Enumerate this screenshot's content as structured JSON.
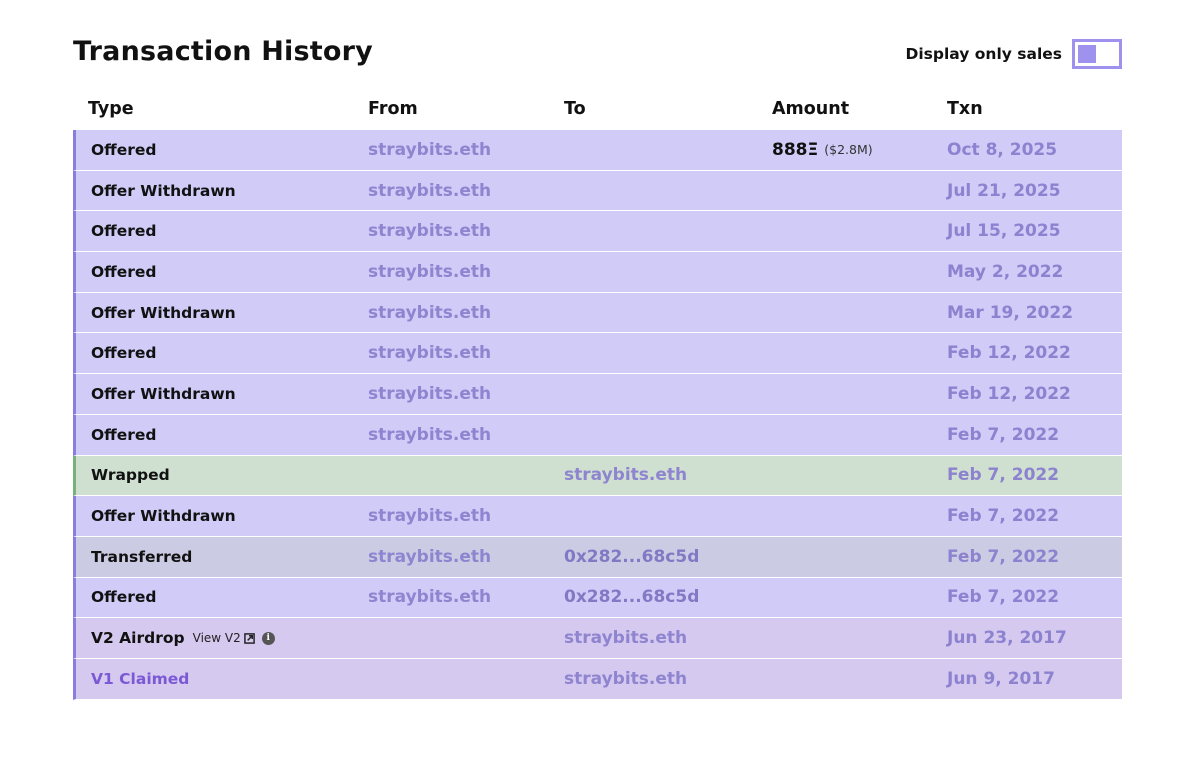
{
  "title": "Transaction History",
  "filter": {
    "label": "Display only sales",
    "accent": "#9e92ee"
  },
  "columns": {
    "type": "Type",
    "from": "From",
    "to": "To",
    "amount": "Amount",
    "txn": "Txn"
  },
  "colors": {
    "offer_bg": "#d1cbf8",
    "wrapped_bg": "#cfe0d0",
    "transferred_bg": "#cbcce4",
    "airdrop_bg": "#d5c9ef",
    "accent_border": "#8a7de0",
    "wrapped_border": "#7ab07c"
  },
  "rows": [
    {
      "type": "Offered",
      "from": "straybits.eth",
      "to": "",
      "amount": "888Ξ",
      "amount_usd": "($2.8M)",
      "date": "Oct 8, 2025",
      "kind": "offer"
    },
    {
      "type": "Offer Withdrawn",
      "from": "straybits.eth",
      "to": "",
      "amount": "",
      "amount_usd": "",
      "date": "Jul 21, 2025",
      "kind": "offer"
    },
    {
      "type": "Offered",
      "from": "straybits.eth",
      "to": "",
      "amount": "",
      "amount_usd": "",
      "date": "Jul 15, 2025",
      "kind": "offer"
    },
    {
      "type": "Offered",
      "from": "straybits.eth",
      "to": "",
      "amount": "",
      "amount_usd": "",
      "date": "May 2, 2022",
      "kind": "offer"
    },
    {
      "type": "Offer Withdrawn",
      "from": "straybits.eth",
      "to": "",
      "amount": "",
      "amount_usd": "",
      "date": "Mar 19, 2022",
      "kind": "offer"
    },
    {
      "type": "Offered",
      "from": "straybits.eth",
      "to": "",
      "amount": "",
      "amount_usd": "",
      "date": "Feb 12, 2022",
      "kind": "offer"
    },
    {
      "type": "Offer Withdrawn",
      "from": "straybits.eth",
      "to": "",
      "amount": "",
      "amount_usd": "",
      "date": "Feb 12, 2022",
      "kind": "offer"
    },
    {
      "type": "Offered",
      "from": "straybits.eth",
      "to": "",
      "amount": "",
      "amount_usd": "",
      "date": "Feb 7, 2022",
      "kind": "offer"
    },
    {
      "type": "Wrapped",
      "from": "",
      "to": "straybits.eth",
      "amount": "",
      "amount_usd": "",
      "date": "Feb 7, 2022",
      "kind": "wrapped"
    },
    {
      "type": "Offer Withdrawn",
      "from": "straybits.eth",
      "to": "",
      "amount": "",
      "amount_usd": "",
      "date": "Feb 7, 2022",
      "kind": "offer"
    },
    {
      "type": "Transferred",
      "from": "straybits.eth",
      "to": "0x282...68c5d",
      "amount": "",
      "amount_usd": "",
      "date": "Feb 7, 2022",
      "kind": "transferred"
    },
    {
      "type": "Offered",
      "from": "straybits.eth",
      "to": "0x282...68c5d",
      "amount": "",
      "amount_usd": "",
      "date": "Feb 7, 2022",
      "kind": "offer"
    },
    {
      "type": "V2 Airdrop",
      "view_link": "View V2",
      "from": "",
      "to": "straybits.eth",
      "amount": "",
      "amount_usd": "",
      "date": "Jun 23, 2017",
      "kind": "airdrop"
    },
    {
      "type": "V1 Claimed",
      "from": "",
      "to": "straybits.eth",
      "amount": "",
      "amount_usd": "",
      "date": "Jun 9, 2017",
      "kind": "claimed"
    }
  ]
}
